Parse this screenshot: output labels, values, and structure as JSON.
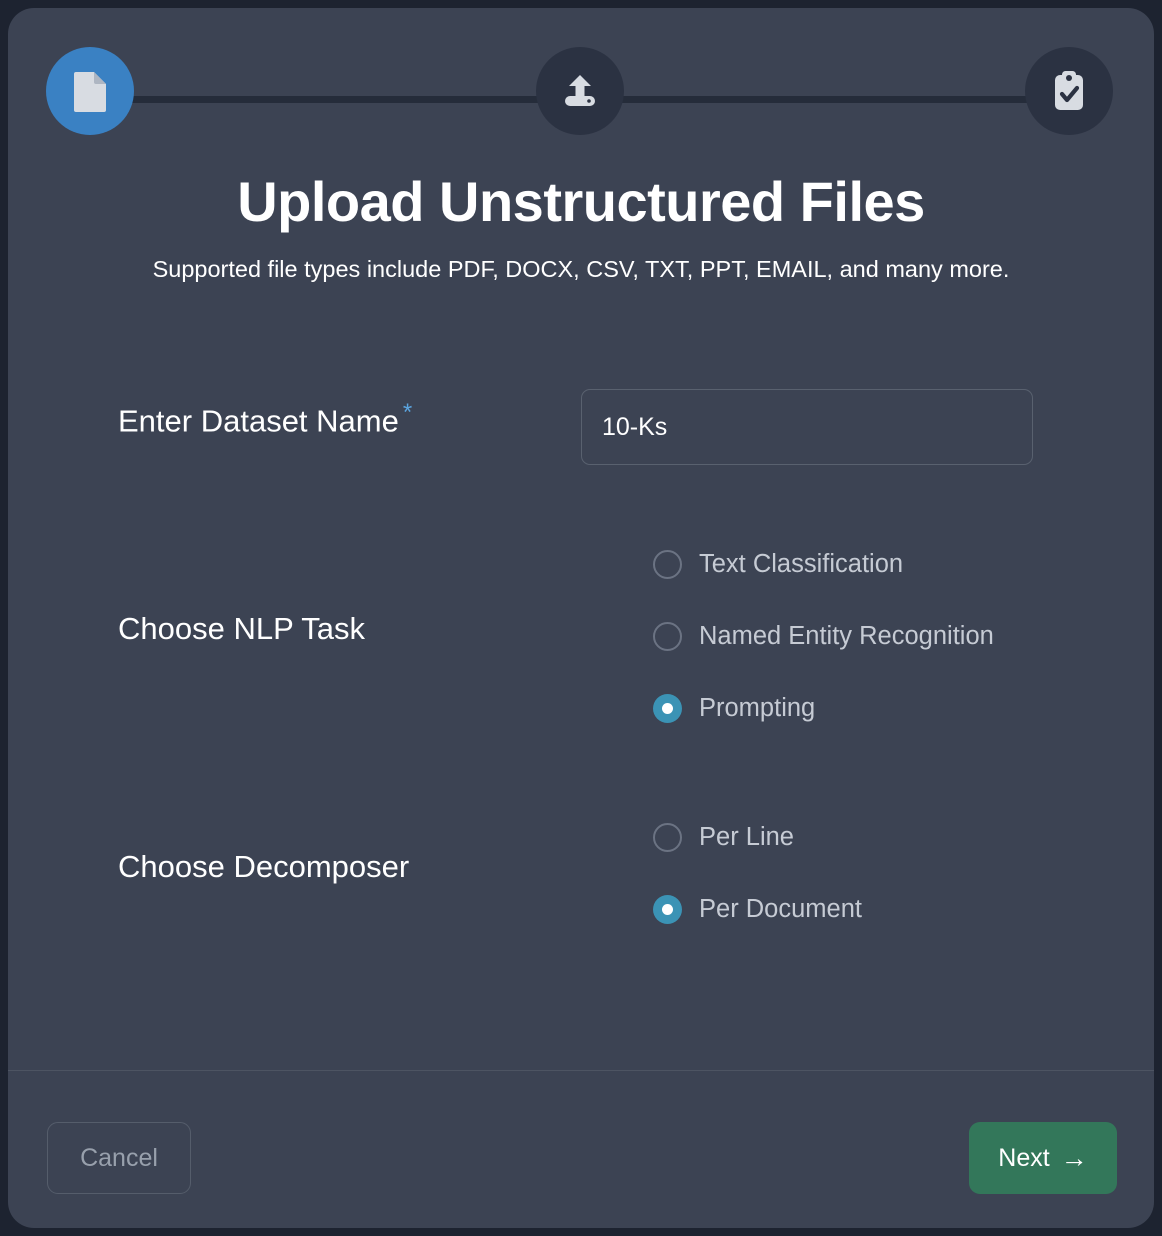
{
  "modal": {
    "title": "Upload Unstructured Files",
    "subtitle": "Supported file types include PDF, DOCX, CSV, TXT, PPT, EMAIL, and many more.",
    "accent_blue": "#3a81c3",
    "accent_radio": "#3b93b5",
    "accent_green": "#33775a",
    "background": "#3c4353"
  },
  "stepper": {
    "steps": [
      {
        "icon": "document-icon",
        "state": "active"
      },
      {
        "icon": "upload-icon",
        "state": "inactive"
      },
      {
        "icon": "clipboard-check-icon",
        "state": "inactive"
      }
    ]
  },
  "form": {
    "dataset": {
      "label": "Enter Dataset Name",
      "required_marker": "*",
      "value": "10-Ks",
      "placeholder": "Enter Dataset Name"
    },
    "nlp_task": {
      "label": "Choose NLP Task",
      "options": [
        {
          "label": "Text Classification",
          "selected": false
        },
        {
          "label": "Named Entity Recognition",
          "selected": false
        },
        {
          "label": "Prompting",
          "selected": true
        }
      ]
    },
    "decomposer": {
      "label": "Choose Decomposer",
      "options": [
        {
          "label": "Per Line",
          "selected": false
        },
        {
          "label": "Per Document",
          "selected": true
        }
      ]
    }
  },
  "footer": {
    "cancel_label": "Cancel",
    "next_label": "Next",
    "next_arrow": "→"
  }
}
